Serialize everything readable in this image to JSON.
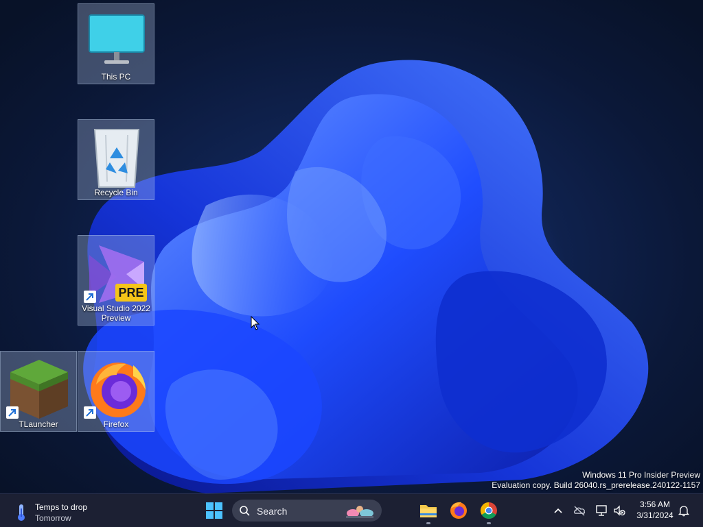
{
  "desktop": {
    "icons": [
      {
        "label": "This PC",
        "icon": "this-pc-icon",
        "selected": true
      },
      {
        "label": "Recycle Bin",
        "icon": "recycle-bin-icon",
        "selected": true
      },
      {
        "label": "Visual Studio 2022 Preview",
        "icon": "visual-studio-preview-icon",
        "badge": "PRE",
        "shortcut": true,
        "selected": true
      },
      {
        "label": "TLauncher",
        "icon": "minecraft-grass-block-icon",
        "shortcut": true,
        "selected": true
      },
      {
        "label": "Firefox",
        "icon": "firefox-icon",
        "shortcut": true,
        "selected": true
      }
    ],
    "watermark": {
      "line1": "Windows 11 Pro Insider Preview",
      "line2": "Evaluation copy. Build 26040.rs_prerelease.240122-1157"
    }
  },
  "taskbar": {
    "weather": {
      "title": "Temps to drop",
      "subtitle": "Tomorrow",
      "icon": "thermometer-icon"
    },
    "start_icon": "windows-logo-icon",
    "search": {
      "placeholder": "Search",
      "icon": "search-icon"
    },
    "apps": [
      {
        "name": "File Explorer",
        "icon": "file-explorer-icon",
        "running": true
      },
      {
        "name": "Firefox",
        "icon": "firefox-icon",
        "running": false
      },
      {
        "name": "Chrome",
        "icon": "chrome-icon",
        "running": true
      }
    ],
    "tray": {
      "icons": [
        "chevron-up-icon",
        "onedrive-offline-icon",
        "network-icon",
        "volume-muted-icon",
        "notification-bell-icon"
      ]
    },
    "clock": {
      "time": "3:56 AM",
      "date": "3/31/2024"
    }
  },
  "colors": {
    "taskbar_bg": "#1c2033",
    "wallpaper_accent": "#1e5bff"
  }
}
